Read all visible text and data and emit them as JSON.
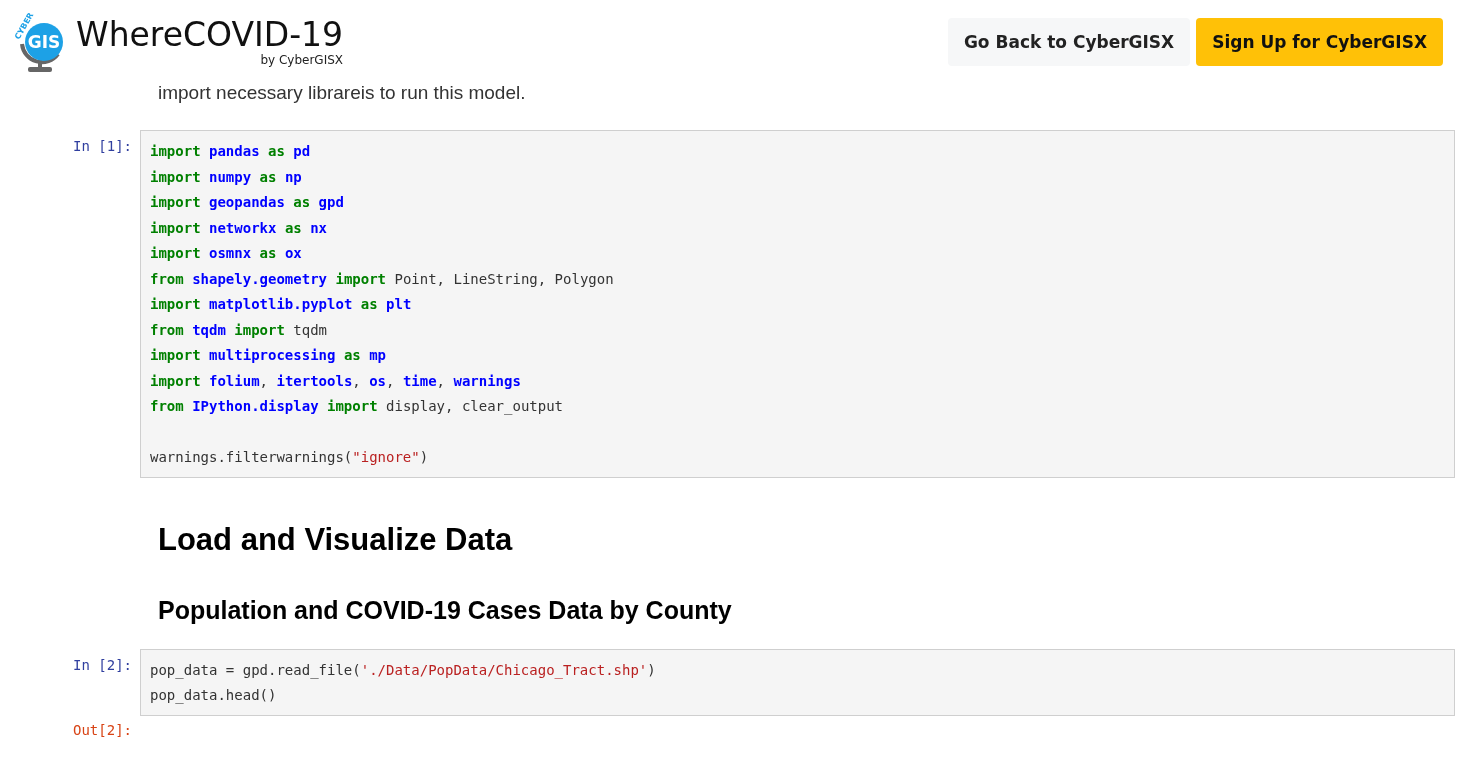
{
  "header": {
    "logo_mark": "GIS",
    "logo_arc": "CYBER",
    "title": "WhereCOVID-19",
    "subtitle": "by CyberGISX",
    "buttons": [
      {
        "label": "Go Back to CyberGISX",
        "kind": "secondary"
      },
      {
        "label": "Sign Up for CyberGISX",
        "kind": "primary"
      }
    ]
  },
  "cells": [
    {
      "kind": "markdown",
      "text": "import necessary librareis to run this model."
    },
    {
      "kind": "code",
      "prompt": "In [1]:",
      "lines": [
        {
          "kind": "code",
          "tokens": [
            {
              "kind": "keyword",
              "text": "import "
            },
            {
              "kind": "name",
              "text": "pandas "
            },
            {
              "kind": "keyword",
              "text": "as "
            },
            {
              "kind": "name",
              "text": "pd"
            }
          ]
        },
        {
          "kind": "code",
          "tokens": [
            {
              "kind": "keyword",
              "text": "import "
            },
            {
              "kind": "name",
              "text": "numpy "
            },
            {
              "kind": "keyword",
              "text": "as "
            },
            {
              "kind": "name",
              "text": "np"
            }
          ]
        },
        {
          "kind": "code",
          "tokens": [
            {
              "kind": "keyword",
              "text": "import "
            },
            {
              "kind": "name",
              "text": "geopandas "
            },
            {
              "kind": "keyword",
              "text": "as "
            },
            {
              "kind": "name",
              "text": "gpd"
            }
          ]
        },
        {
          "kind": "code",
          "tokens": [
            {
              "kind": "keyword",
              "text": "import "
            },
            {
              "kind": "name",
              "text": "networkx "
            },
            {
              "kind": "keyword",
              "text": "as "
            },
            {
              "kind": "name",
              "text": "nx"
            }
          ]
        },
        {
          "kind": "code",
          "tokens": [
            {
              "kind": "keyword",
              "text": "import "
            },
            {
              "kind": "name",
              "text": "osmnx "
            },
            {
              "kind": "keyword",
              "text": "as "
            },
            {
              "kind": "name",
              "text": "ox"
            }
          ]
        },
        {
          "kind": "code",
          "tokens": [
            {
              "kind": "keyword",
              "text": "from "
            },
            {
              "kind": "name",
              "text": "shapely.geometry "
            },
            {
              "kind": "keyword",
              "text": "import "
            },
            {
              "kind": "plain",
              "text": "Point, LineString, Polygon"
            }
          ]
        },
        {
          "kind": "code",
          "tokens": [
            {
              "kind": "keyword",
              "text": "import "
            },
            {
              "kind": "name",
              "text": "matplotlib.pyplot "
            },
            {
              "kind": "keyword",
              "text": "as "
            },
            {
              "kind": "name",
              "text": "plt"
            }
          ]
        },
        {
          "kind": "code",
          "tokens": [
            {
              "kind": "keyword",
              "text": "from "
            },
            {
              "kind": "name",
              "text": "tqdm "
            },
            {
              "kind": "keyword",
              "text": "import "
            },
            {
              "kind": "plain",
              "text": "tqdm"
            }
          ]
        },
        {
          "kind": "code",
          "tokens": [
            {
              "kind": "keyword",
              "text": "import "
            },
            {
              "kind": "name",
              "text": "multiprocessing "
            },
            {
              "kind": "keyword",
              "text": "as "
            },
            {
              "kind": "name",
              "text": "mp"
            }
          ]
        },
        {
          "kind": "code",
          "tokens": [
            {
              "kind": "keyword",
              "text": "import "
            },
            {
              "kind": "name",
              "text": "folium"
            },
            {
              "kind": "plain",
              "text": ", "
            },
            {
              "kind": "name",
              "text": "itertools"
            },
            {
              "kind": "plain",
              "text": ", "
            },
            {
              "kind": "name",
              "text": "os"
            },
            {
              "kind": "plain",
              "text": ", "
            },
            {
              "kind": "name",
              "text": "time"
            },
            {
              "kind": "plain",
              "text": ", "
            },
            {
              "kind": "name",
              "text": "warnings"
            }
          ]
        },
        {
          "kind": "code",
          "tokens": [
            {
              "kind": "keyword",
              "text": "from "
            },
            {
              "kind": "name",
              "text": "IPython.display "
            },
            {
              "kind": "keyword",
              "text": "import "
            },
            {
              "kind": "plain",
              "text": "display, clear_output"
            }
          ]
        },
        {
          "kind": "blank"
        },
        {
          "kind": "code",
          "tokens": [
            {
              "kind": "plain",
              "text": "warnings.filterwarnings("
            },
            {
              "kind": "string",
              "text": "\"ignore\""
            },
            {
              "kind": "plain",
              "text": ")"
            }
          ]
        }
      ]
    },
    {
      "kind": "h2",
      "text": "Load and Visualize Data"
    },
    {
      "kind": "h3",
      "text": "Population and COVID-19 Cases Data by County"
    },
    {
      "kind": "code",
      "prompt": "In [2]:",
      "lines": [
        {
          "kind": "code",
          "tokens": [
            {
              "kind": "plain",
              "text": "pop_data = gpd.read_file("
            },
            {
              "kind": "string",
              "text": "'./Data/PopData/Chicago_Tract.shp'"
            },
            {
              "kind": "plain",
              "text": ")"
            }
          ]
        },
        {
          "kind": "code",
          "tokens": [
            {
              "kind": "plain",
              "text": "pop_data.head()"
            }
          ]
        }
      ]
    },
    {
      "kind": "output",
      "prompt": "Out[2]:"
    }
  ]
}
